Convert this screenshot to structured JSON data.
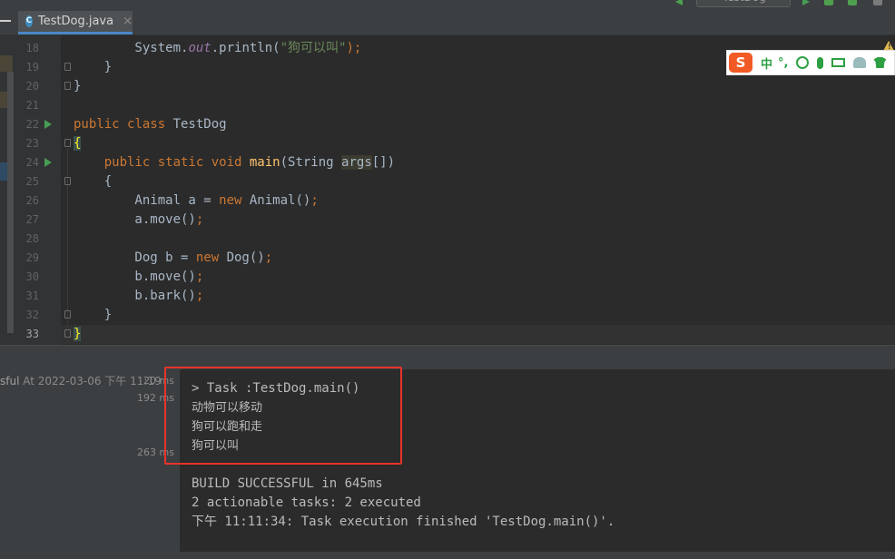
{
  "tab": {
    "label": "TestDog.java",
    "close": "×",
    "icon": "C"
  },
  "run_config": {
    "label": "TestDog"
  },
  "ime": {
    "logo": "S",
    "mode": "中",
    "punct": "°,"
  },
  "editor": {
    "lines": [
      {
        "num": "18"
      },
      {
        "num": "19"
      },
      {
        "num": "20"
      },
      {
        "num": "21"
      },
      {
        "num": "22"
      },
      {
        "num": "23"
      },
      {
        "num": "24"
      },
      {
        "num": "25"
      },
      {
        "num": "26"
      },
      {
        "num": "27"
      },
      {
        "num": "28"
      },
      {
        "num": "29"
      },
      {
        "num": "30"
      },
      {
        "num": "31"
      },
      {
        "num": "32"
      },
      {
        "num": "33"
      }
    ],
    "code": {
      "l18_a": "        System.",
      "l18_field": "out",
      "l18_b": ".println(",
      "l18_str": "\"狗可以叫\"",
      "l18_c": ");",
      "l19": "    }",
      "l20": "}",
      "l22_kw": "public class ",
      "l22_name": "TestDog",
      "l23": "{",
      "l24_kw": "    public static void ",
      "l24_method": "main",
      "l24_a": "(String ",
      "l24_param": "args",
      "l24_b": "[])",
      "l25": "    {",
      "l26_a": "        Animal a = ",
      "l26_kw": "new ",
      "l26_b": "Animal()",
      "l26_c": ";",
      "l27_a": "        a.move()",
      "l27_c": ";",
      "l29_a": "        Dog b = ",
      "l29_kw": "new ",
      "l29_b": "Dog()",
      "l29_c": ";",
      "l30_a": "        b.move()",
      "l30_c": ";",
      "l31_a": "        b.bark()",
      "l31_c": ";",
      "l32": "    }",
      "l33": "}"
    }
  },
  "run_tree": {
    "row1_status": "sful",
    "row1_text": " At 2022-03-06 下午 11:19",
    "row1_time": "20 ms",
    "row2_time": "192 ms",
    "row3_time": "263 ms"
  },
  "console": {
    "lines": [
      "> Task :TestDog.main()",
      "动物可以移动",
      "狗可以跑和走",
      "狗可以叫",
      "",
      "BUILD SUCCESSFUL in 645ms",
      "2 actionable tasks: 2 executed",
      "下午 11:11:34: Task execution finished 'TestDog.main()'."
    ]
  }
}
